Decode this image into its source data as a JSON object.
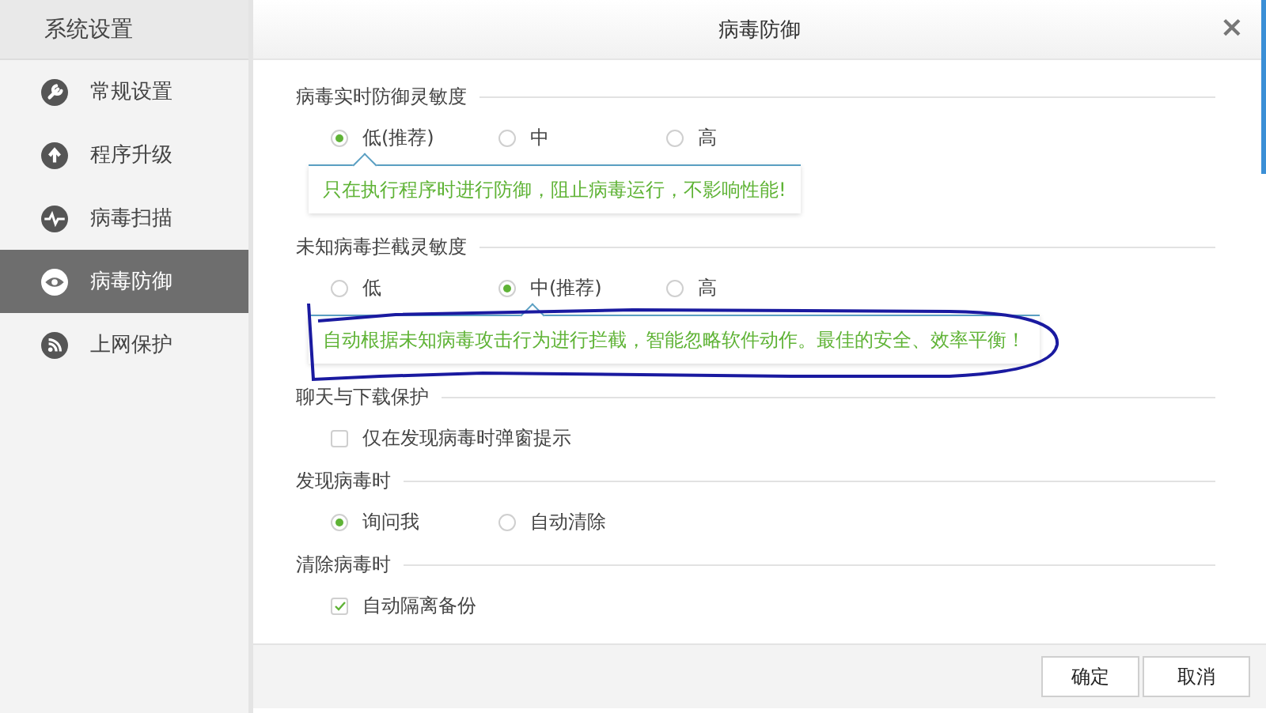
{
  "sidebar": {
    "title": "系统设置",
    "items": [
      {
        "label": "常规设置",
        "selected": false
      },
      {
        "label": "程序升级",
        "selected": false
      },
      {
        "label": "病毒扫描",
        "selected": false
      },
      {
        "label": "病毒防御",
        "selected": true
      },
      {
        "label": "上网保护",
        "selected": false
      }
    ]
  },
  "dialog": {
    "title": "病毒防御",
    "close": "×",
    "sections": [
      {
        "title": "病毒实时防御灵敏度",
        "kind": "radio",
        "options": [
          {
            "label": "低(推荐)",
            "selected": true
          },
          {
            "label": "中",
            "selected": false
          },
          {
            "label": "高",
            "selected": false
          }
        ],
        "tip": "只在执行程序时进行防御，阻止病毒运行，不影响性能!"
      },
      {
        "title": "未知病毒拦截灵敏度",
        "kind": "radio",
        "options": [
          {
            "label": "低",
            "selected": false
          },
          {
            "label": "中(推荐)",
            "selected": true
          },
          {
            "label": "高",
            "selected": false
          }
        ],
        "tip": "自动根据未知病毒攻击行为进行拦截，智能忽略软件动作。最佳的安全、效率平衡！"
      },
      {
        "title": "聊天与下载保护",
        "kind": "checkbox",
        "options": [
          {
            "label": "仅在发现病毒时弹窗提示",
            "checked": false
          }
        ]
      },
      {
        "title": "发现病毒时",
        "kind": "radio",
        "options": [
          {
            "label": "询问我",
            "selected": true
          },
          {
            "label": "自动清除",
            "selected": false
          }
        ]
      },
      {
        "title": "清除病毒时",
        "kind": "checkbox",
        "options": [
          {
            "label": "自动隔离备份",
            "checked": true
          }
        ]
      }
    ],
    "buttons": [
      "确定",
      "取消"
    ]
  }
}
